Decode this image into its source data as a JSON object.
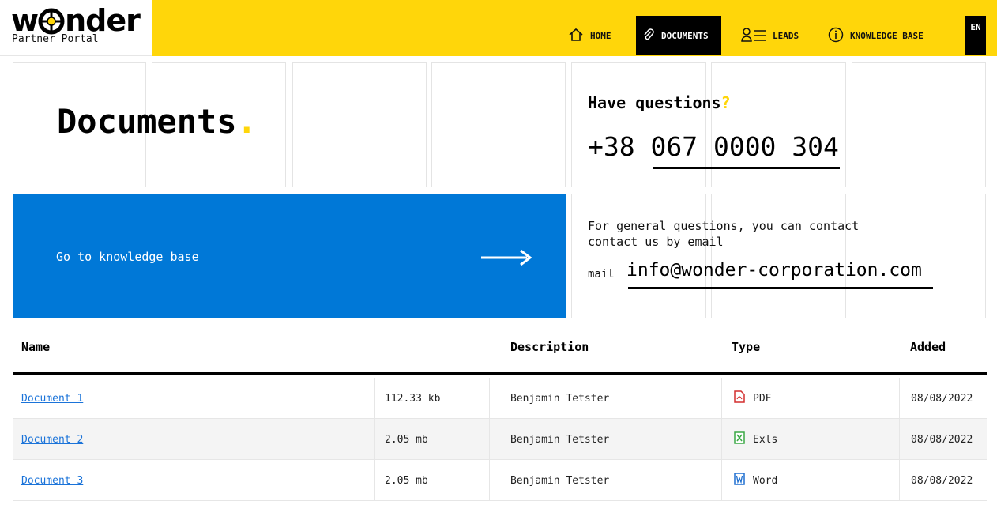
{
  "brand": {
    "name": "wonder",
    "name_left": "w",
    "name_right": "nder",
    "subtitle": "Partner Portal"
  },
  "nav": {
    "items": [
      {
        "label": "HOME",
        "icon": "home-icon"
      },
      {
        "label": "DOCUMENTS",
        "icon": "paperclip-icon",
        "active": true
      },
      {
        "label": "LEADS",
        "icon": "user-list-icon"
      },
      {
        "label": "KNOWLEDGE BASE",
        "icon": "info-icon"
      }
    ],
    "language": "EN"
  },
  "page": {
    "title": "Documents",
    "title_dot": "."
  },
  "questions": {
    "heading": "Have questions",
    "heading_mark": "?",
    "phone_prefix": "+38",
    "phone_number": "067 0000 304"
  },
  "knowledge_base_link": {
    "label": "Go to knowledge base",
    "icon": "arrow-right-icon"
  },
  "contact": {
    "text": "For general questions, you can contact contact us by email",
    "mail_label": "mail",
    "email": "info@wonder-corporation.com"
  },
  "table": {
    "headers": {
      "name": "Name",
      "description": "Description",
      "type": "Type",
      "added": "Added"
    },
    "rows": [
      {
        "name": "Document 1",
        "size": "112.33 kb",
        "description": "Benjamin Tetster",
        "type": "PDF",
        "type_icon": "pdf-file-icon",
        "added": "08/08/2022"
      },
      {
        "name": "Document 2",
        "size": "2.05 mb",
        "description": "Benjamin Tetster",
        "type": "Exls",
        "type_icon": "excel-file-icon",
        "added": "08/08/2022"
      },
      {
        "name": "Document 3",
        "size": "2.05 mb",
        "description": "Benjamin Tetster",
        "type": "Word",
        "type_icon": "word-file-icon",
        "added": "08/08/2022"
      }
    ]
  },
  "colors": {
    "accent_yellow": "#ffd60a",
    "link_blue": "#1a73d9",
    "tile_blue": "#0078d7",
    "pdf_red": "#d32f2f",
    "excel_green": "#3aa845",
    "word_blue": "#1e6fd0"
  }
}
